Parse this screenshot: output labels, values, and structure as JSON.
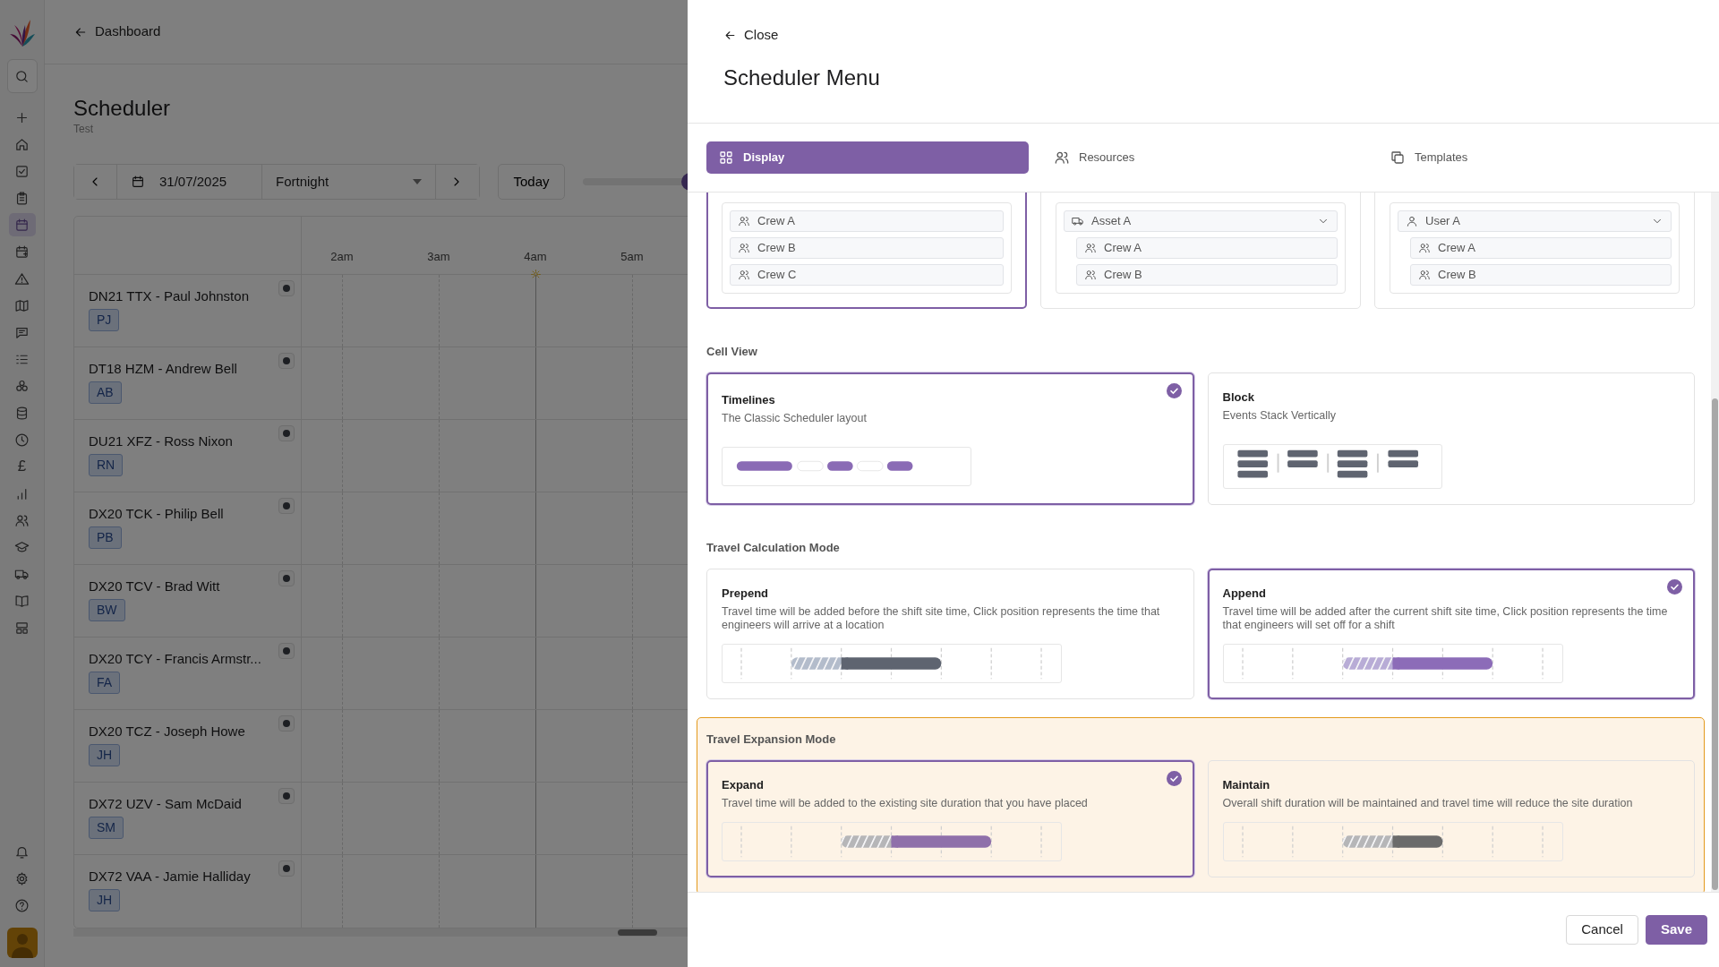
{
  "app": {
    "back_link": "Dashboard",
    "title": "Scheduler",
    "subtitle": "Test",
    "sidebar": {
      "items": [
        {
          "selected": false
        },
        {
          "selected": false
        },
        {
          "selected": false
        },
        {
          "selected": false
        },
        {
          "selected": false
        },
        {
          "selected": true
        },
        {
          "selected": false
        },
        {
          "selected": false
        },
        {
          "selected": false
        },
        {
          "selected": false
        },
        {
          "selected": false
        },
        {
          "selected": false
        },
        {
          "selected": false
        },
        {
          "selected": false
        },
        {
          "glyph": "£",
          "selected": false
        },
        {
          "selected": false
        },
        {
          "selected": false
        },
        {
          "selected": false
        },
        {
          "selected": false
        },
        {
          "selected": false
        },
        {
          "selected": false
        }
      ]
    },
    "toolbar": {
      "date": "31/07/2025",
      "range": "Fortnight",
      "today": "Today",
      "zoom": {
        "level": 0.8
      }
    },
    "hours": [
      {
        "label": "2am",
        "current": false
      },
      {
        "label": "3am",
        "current": false
      },
      {
        "label": "4am",
        "current": true
      },
      {
        "label": "5am",
        "current": false
      }
    ],
    "resources": [
      {
        "name": "DN21 TTX - Paul Johnston",
        "initials": "PJ"
      },
      {
        "name": "DT18 HZM - Andrew Bell",
        "initials": "AB"
      },
      {
        "name": "DU21 XFZ - Ross Nixon",
        "initials": "RN"
      },
      {
        "name": "DX20 TCK - Philip Bell",
        "initials": "PB"
      },
      {
        "name": "DX20 TCV - Brad Witt",
        "initials": "BW"
      },
      {
        "name": "DX20 TCY - Francis Armstr...",
        "initials": "FA"
      },
      {
        "name": "DX20 TCZ - Joseph Howe",
        "initials": "JH"
      },
      {
        "name": "DX72 UZV - Sam McDaid",
        "initials": "SM"
      },
      {
        "name": "DX72 VAA - Jamie Halliday",
        "initials": "JH"
      }
    ]
  },
  "panel": {
    "close": "Close",
    "title": "Scheduler Menu",
    "tabs": [
      {
        "label": "Display",
        "selected": true
      },
      {
        "label": "Resources",
        "selected": false
      },
      {
        "label": "Templates",
        "selected": false
      }
    ],
    "grouping_options": [
      {
        "selected": true,
        "rows": [
          {
            "label": "Crew A",
            "kind": "crew"
          },
          {
            "label": "Crew B",
            "kind": "crew"
          },
          {
            "label": "Crew C",
            "kind": "crew"
          }
        ]
      },
      {
        "selected": false,
        "rows": [
          {
            "label": "Asset A",
            "kind": "asset",
            "expanded": true,
            "children": [
              {
                "label": "Crew A",
                "kind": "crew"
              },
              {
                "label": "Crew B",
                "kind": "crew"
              }
            ]
          }
        ]
      },
      {
        "selected": false,
        "rows": [
          {
            "label": "User A",
            "kind": "user",
            "expanded": true,
            "children": [
              {
                "label": "Crew A",
                "kind": "crew"
              },
              {
                "label": "Crew B",
                "kind": "crew"
              }
            ]
          }
        ]
      }
    ],
    "sections": [
      {
        "label": "Cell View",
        "highlighted": false,
        "options": [
          {
            "kind": "timeline",
            "title": "Timelines",
            "description": "The Classic Scheduler layout",
            "selected": true
          },
          {
            "kind": "block",
            "title": "Block",
            "description": "Events Stack Vertically",
            "selected": false
          }
        ]
      },
      {
        "label": "Travel Calculation Mode",
        "highlighted": false,
        "options": [
          {
            "kind": "prepend",
            "title": "Prepend",
            "description": "Travel time will be added before the shift site time, Click position represents the time that engineers will arrive at a location",
            "selected": false
          },
          {
            "kind": "append",
            "title": "Append",
            "description": "Travel time will be added after the current shift site time, Click position represents the time that engineers will set off for a shift",
            "selected": true
          }
        ]
      },
      {
        "label": "Travel Expansion Mode",
        "highlighted": true,
        "options": [
          {
            "kind": "expand",
            "title": "Expand",
            "description": "Travel time will be added to the existing site duration that you have placed",
            "selected": true
          },
          {
            "kind": "maintain",
            "title": "Maintain",
            "description": "Overall shift duration will be maintained and travel time will reduce the site duration",
            "selected": false
          }
        ]
      }
    ],
    "buttons": [
      {
        "label": "Cancel",
        "kind": "secondary"
      },
      {
        "label": "Save",
        "kind": "primary"
      }
    ]
  }
}
